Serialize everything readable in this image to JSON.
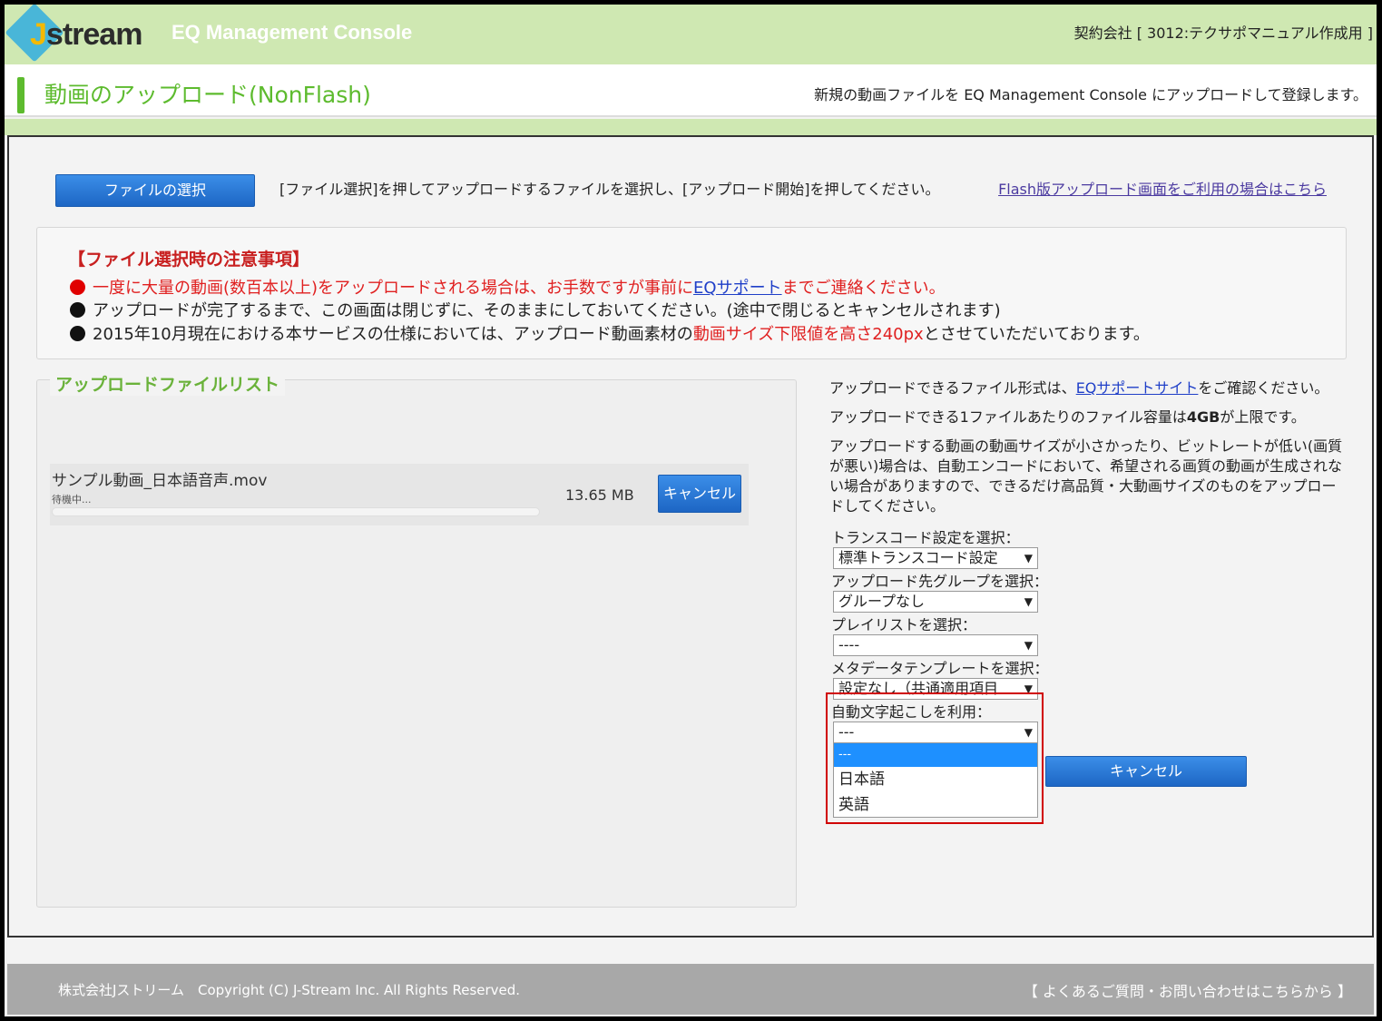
{
  "header": {
    "logo_text_j": "J",
    "logo_text_rest": "stream",
    "app_title": "EQ Management Console",
    "contract": "契約会社 [ 3012:テクサポマニュアル作成用 ]"
  },
  "title_bar": {
    "title": "動画のアップロード(NonFlash)",
    "description": "新規の動画ファイルを EQ Management Console にアップロードして登録します。"
  },
  "toolbar": {
    "file_button": "ファイルの選択",
    "instruction": "[ファイル選択]を押してアップロードするファイルを選択し、[アップロード開始]を押してください。",
    "flash_link": "Flash版アップロード画面をご利用の場合はこちら"
  },
  "notice": {
    "title": "【ファイル選択時の注意事項】",
    "line1_a": "一度に大量の動画(数百本以上)をアップロードされる場合は、お手数ですが事前に",
    "line1_link": "EQサポート",
    "line1_b": "までご連絡ください。",
    "line2": "アップロードが完了するまで、この画面は閉じずに、そのままにしておいてください。(途中で閉じるとキャンセルされます)",
    "line3_a": "2015年10月現在における本サービスの仕様においては、アップロード動画素材の",
    "line3_red": "動画サイズ下限値を高さ240px",
    "line3_b": "とさせていただいております。",
    "colors": {
      "warning": "#e02020",
      "link": "#1f3fc8"
    }
  },
  "upload_list": {
    "title": "アップロードファイルリスト",
    "files": [
      {
        "name": "サンプル動画_日本語音声.mov",
        "status": "待機中...",
        "size": "13.65 MB",
        "cancel": "キャンセル",
        "progress": 0
      }
    ]
  },
  "side": {
    "info1_a": "アップロードできるファイル形式は、",
    "info1_link": "EQサポートサイト",
    "info1_b": "をご確認ください。",
    "info2_a": "アップロードできる1ファイルあたりのファイル容量は",
    "info2_bold": "4GB",
    "info2_b": "が上限です。",
    "info3": "アップロードする動画の動画サイズが小さかったり、ビットレートが低い(画質が悪い)場合は、自動エンコードにおいて、希望される画質の動画が生成されない場合がありますので、できるだけ高品質・大動画サイズのものをアップロードしてください。"
  },
  "form": {
    "transcode": {
      "label": "トランスコード設定を選択：",
      "value": "標準トランスコード設定"
    },
    "group": {
      "label": "アップロード先グループを選択：",
      "value": "グループなし"
    },
    "playlist": {
      "label": "プレイリストを選択：",
      "value": "----"
    },
    "metadata": {
      "label": "メタデータテンプレートを選択：",
      "value": "設定なし（共通適用項目"
    },
    "transcription": {
      "label": "自動文字起こしを利用：",
      "value": "---",
      "options": [
        "---",
        "日本語",
        "英語"
      ]
    },
    "cancel_button": "キャンセル",
    "arrow": "▼"
  },
  "footer": {
    "copyright": "株式会社Jストリーム　Copyright (C) J-Stream Inc. All Rights Reserved.",
    "faq": "【 よくあるご質問・お問い合わせはこちらから 】"
  }
}
